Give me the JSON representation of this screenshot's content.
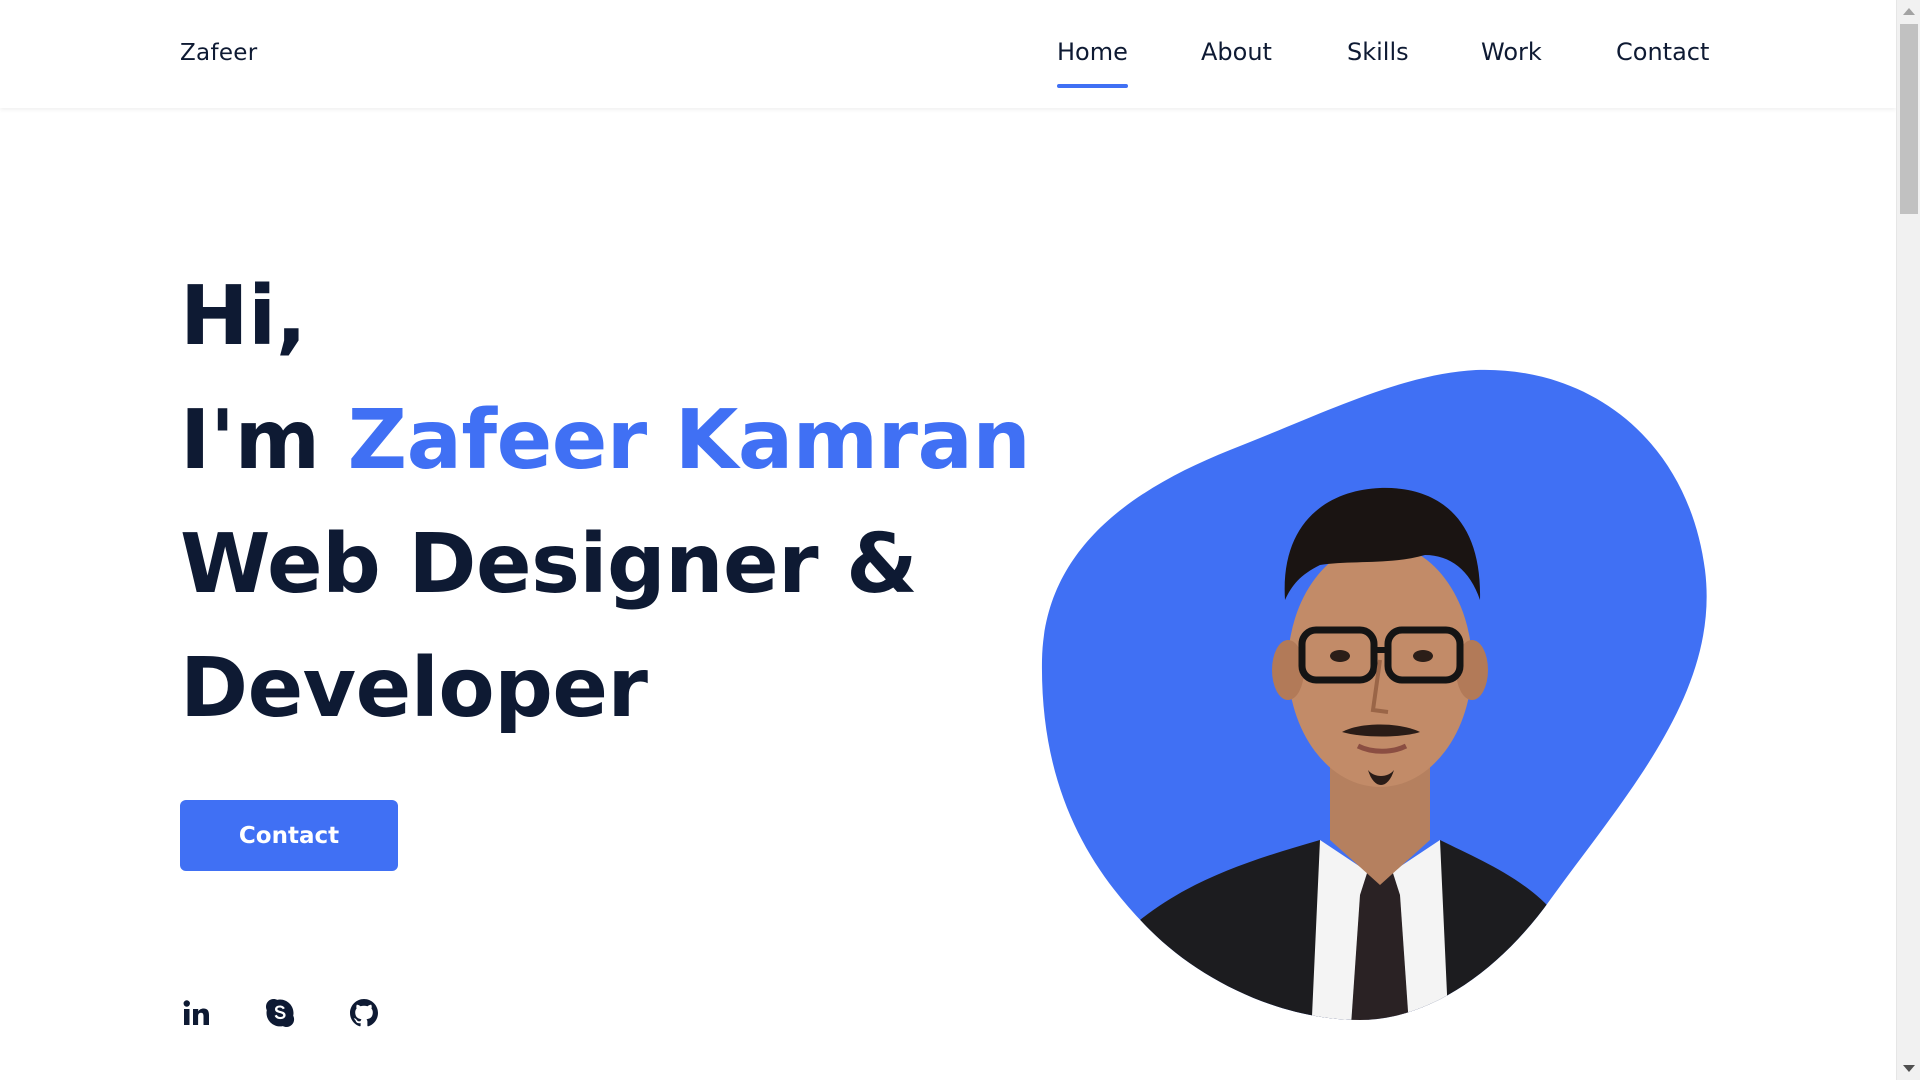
{
  "header": {
    "logo": "Zafeer",
    "nav": [
      {
        "label": "Home",
        "active": true
      },
      {
        "label": "About",
        "active": false
      },
      {
        "label": "Skills",
        "active": false
      },
      {
        "label": "Work",
        "active": false
      },
      {
        "label": "Contact",
        "active": false
      }
    ]
  },
  "hero": {
    "line1": "Hi,",
    "line2_prefix": "I'm ",
    "line2_name": "Zafeer Kamran",
    "line3": "Web Designer &",
    "line4": "Developer",
    "cta_label": "Contact"
  },
  "social": [
    {
      "icon": "linkedin-icon"
    },
    {
      "icon": "skype-icon"
    },
    {
      "icon": "github-icon"
    }
  ],
  "colors": {
    "accent": "#4070f4",
    "text": "#0e1a33",
    "background": "#ffffff"
  }
}
